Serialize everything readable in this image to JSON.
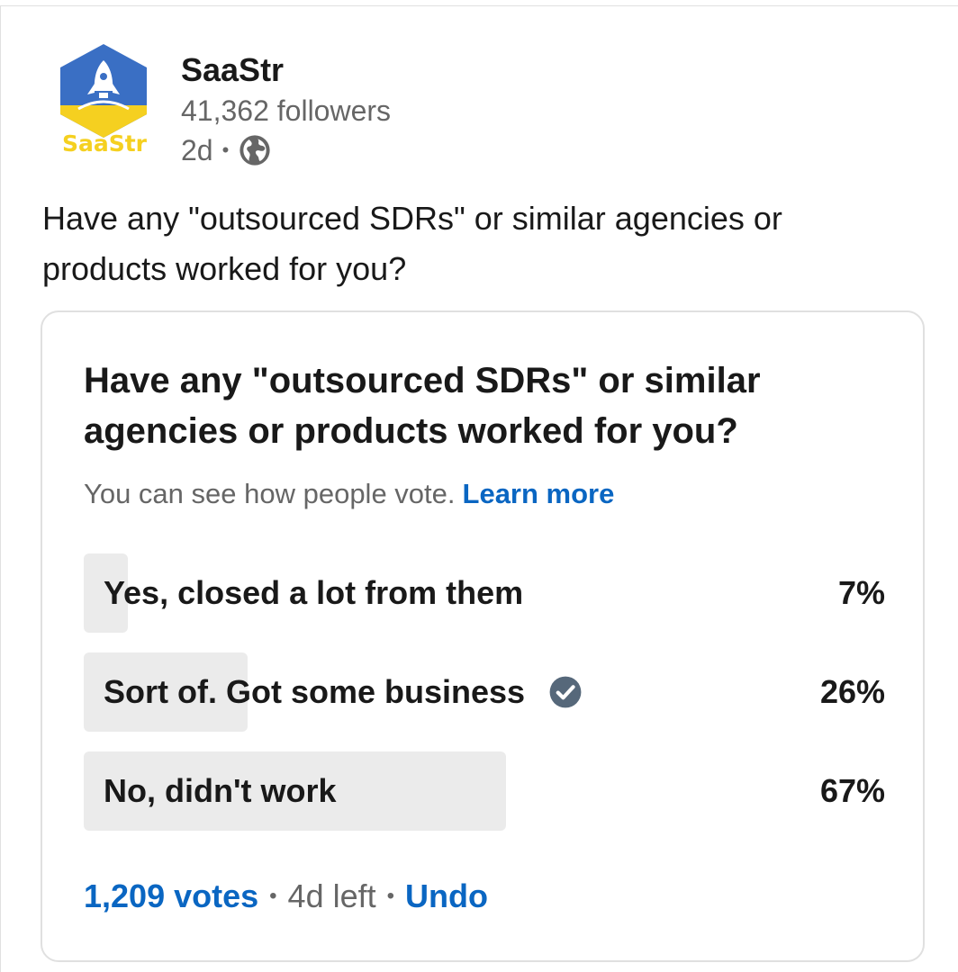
{
  "post": {
    "company_name": "SaaStr",
    "logo_text": "SaaStr",
    "followers": "41,362 followers",
    "time": "2d",
    "separator": "•",
    "visibility_icon": "globe-icon",
    "text": "Have any \"outsourced SDRs\" or similar agencies or products worked for you?"
  },
  "poll": {
    "question": "Have any \"outsourced SDRs\" or similar agencies or products worked for you?",
    "visibility_note": "You can see how people vote.",
    "learn_more": "Learn more",
    "options": [
      {
        "label": "Yes, closed a lot from them",
        "percent_label": "7%",
        "share": 0.07,
        "selected": false
      },
      {
        "label": "Sort of. Got some business",
        "percent_label": "26%",
        "share": 0.26,
        "selected": true
      },
      {
        "label": "No, didn't work",
        "percent_label": "67%",
        "share": 0.67,
        "selected": false
      }
    ],
    "votes": "1,209 votes",
    "separator": "•",
    "time_left": "4d left",
    "undo": "Undo"
  },
  "colors": {
    "link": "#0a66c2",
    "bar_fill": "#ebebeb",
    "check": "#56687a",
    "logo_blue": "#3a6fc4",
    "logo_yellow": "#f5d020"
  }
}
